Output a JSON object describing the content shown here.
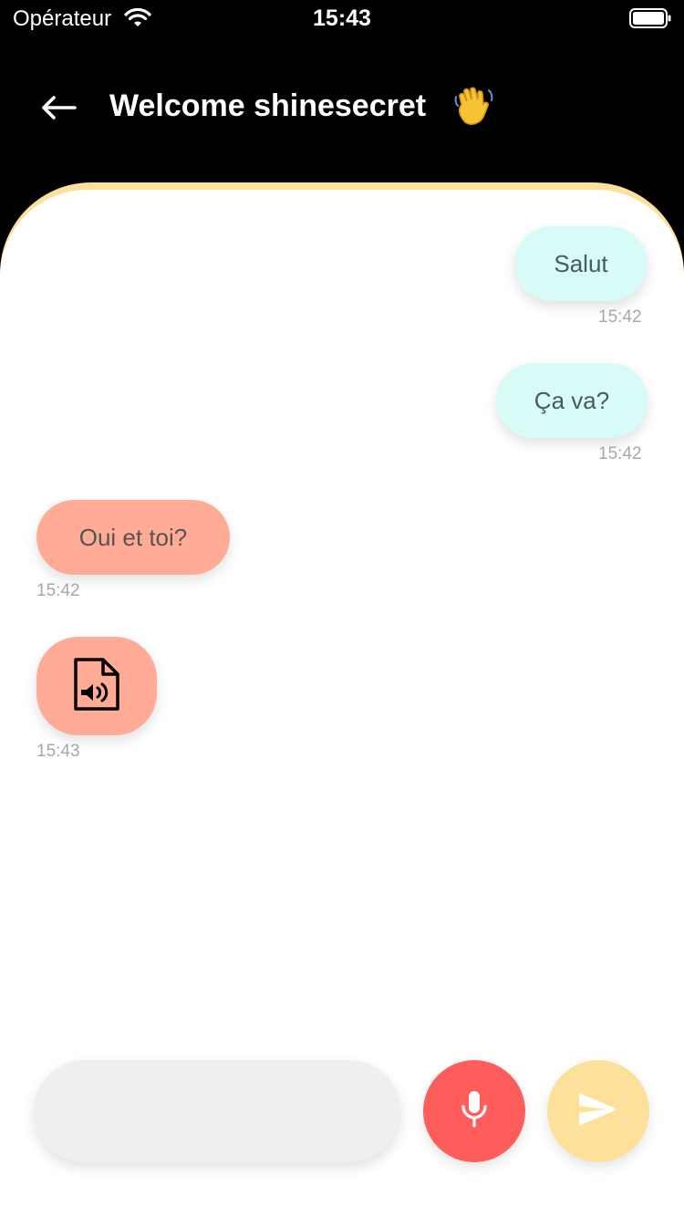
{
  "status_bar": {
    "carrier": "Opérateur",
    "time": "15:43"
  },
  "header": {
    "title": "Welcome shinesecret",
    "emoji": "👋"
  },
  "colors": {
    "header_bg": "#000000",
    "accent": "#fde19a",
    "sent_bubble": "#d8fbf8",
    "received_bubble": "#ffab96",
    "mic_button": "#ff5c5c",
    "send_button": "#fde19a",
    "input_bg": "#efefef"
  },
  "messages": [
    {
      "direction": "sent",
      "text": "Salut",
      "time": "15:42"
    },
    {
      "direction": "sent",
      "text": "Ça va?",
      "time": "15:42"
    },
    {
      "direction": "received",
      "text": "Oui et toi?",
      "time": "15:42"
    },
    {
      "direction": "received",
      "type": "audio",
      "icon": "audio-file-icon",
      "time": "15:43"
    }
  ],
  "composer": {
    "value": "",
    "placeholder": ""
  },
  "icons": {
    "back": "arrow-left-icon",
    "mic": "microphone-icon",
    "send": "send-icon"
  }
}
